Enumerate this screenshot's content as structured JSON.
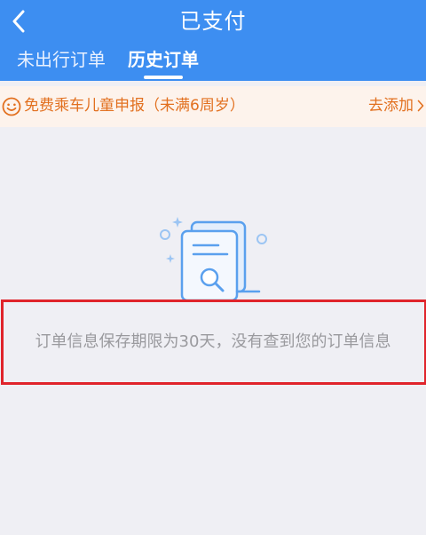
{
  "header": {
    "title": "已支付",
    "back_icon": "chevron-left-icon",
    "tabs": [
      {
        "label": "未出行订单",
        "active": false
      },
      {
        "label": "历史订单",
        "active": true
      }
    ],
    "color": "#3d8ef1"
  },
  "notice": {
    "icon": "smile-icon",
    "text": "免费乘车儿童申报（未满6周岁）",
    "action_label": "去添加",
    "action_icon": "chevron-right-icon",
    "color": "#e2701f"
  },
  "empty_state": {
    "illustration_icon": "document-search-icon",
    "message": "订单信息保存期限为30天，没有查到您的订单信息"
  },
  "annotation": {
    "highlight_color": "#e0242b"
  }
}
